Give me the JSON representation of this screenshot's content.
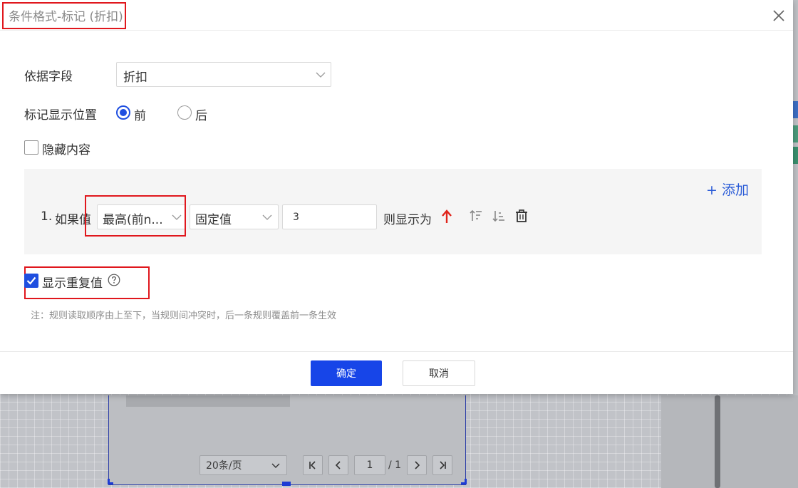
{
  "dialog": {
    "title": "条件格式-标记 (折扣)",
    "close_icon": "close-icon"
  },
  "form": {
    "field_label": "依据字段",
    "field_value": "折扣",
    "position_label": "标记显示位置",
    "position_options": [
      {
        "label": "前",
        "checked": true
      },
      {
        "label": "后",
        "checked": false
      }
    ],
    "hide_content_label": "隐藏内容",
    "hide_content_checked": false
  },
  "rules": {
    "add_label": "+ 添加",
    "items": [
      {
        "index": "1.",
        "prefix": "如果值",
        "condition": "最高(前n...",
        "value_type": "固定值",
        "value": "3",
        "then_label": "则显示为",
        "icon": "arrow-up-icon",
        "icon_color": "#e0241b"
      }
    ],
    "tools": [
      "sort-asc-icon",
      "sort-desc-icon",
      "trash-icon"
    ]
  },
  "show_duplicates": {
    "label": "显示重复值",
    "checked": true,
    "help_icon": "help-icon"
  },
  "note": "注：规则读取顺序由上至下，当规则间冲突时，后一条规则覆盖前一条生效",
  "footer": {
    "ok_label": "确定",
    "cancel_label": "取消"
  },
  "background": {
    "page_size": "20条/页",
    "current_page": "1",
    "total_pages": "/ 1"
  },
  "colors": {
    "primary": "#1745e8",
    "highlight": "#e0171d",
    "link": "#2a5bd7"
  }
}
